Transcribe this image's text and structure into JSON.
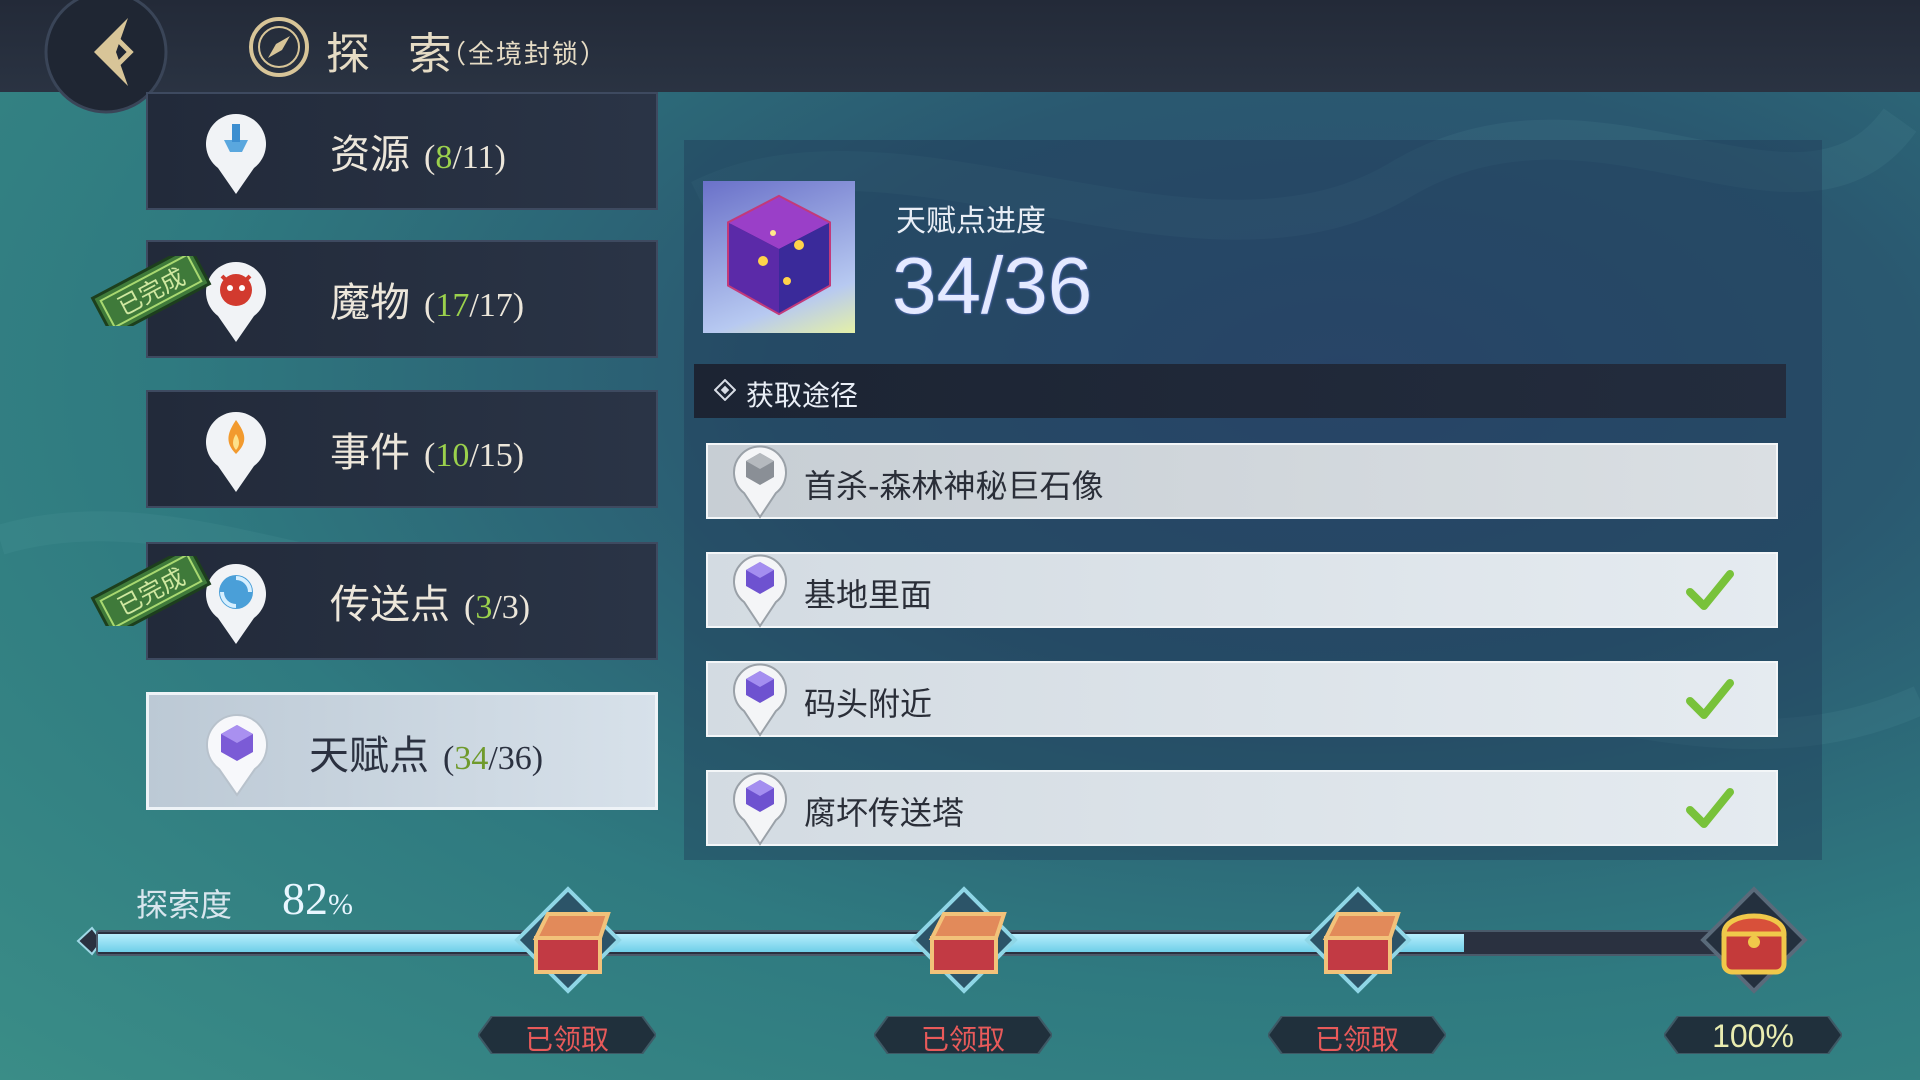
{
  "header": {
    "title": "探 索",
    "subtitle": "（全境封锁）"
  },
  "categories": [
    {
      "label": "资源",
      "done": "8",
      "total": "11",
      "completed": false,
      "stamp_text": ""
    },
    {
      "label": "魔物",
      "done": "17",
      "total": "17",
      "completed": true,
      "stamp_text": "已完成"
    },
    {
      "label": "事件",
      "done": "10",
      "total": "15",
      "completed": false,
      "stamp_text": ""
    },
    {
      "label": "传送点",
      "done": "3",
      "total": "3",
      "completed": true,
      "stamp_text": "已完成"
    },
    {
      "label": "天赋点",
      "done": "34",
      "total": "36",
      "completed": false,
      "selected": true,
      "stamp_text": ""
    }
  ],
  "detail": {
    "progress_label": "天赋点进度",
    "progress_value": "34/36",
    "ways_header": "获取途径",
    "ways": [
      {
        "label": "首杀-森林神秘巨石像",
        "obtained": false
      },
      {
        "label": "基地里面",
        "obtained": true
      },
      {
        "label": "码头附近",
        "obtained": true
      },
      {
        "label": "腐坏传送塔",
        "obtained": true
      }
    ]
  },
  "exploration": {
    "label": "探索度",
    "value": "82",
    "unit": "%",
    "progress_fraction": 0.82,
    "rewards": [
      {
        "label": "已领取",
        "claimed": true
      },
      {
        "label": "已领取",
        "claimed": true
      },
      {
        "label": "已领取",
        "claimed": true
      },
      {
        "label": "100%",
        "claimed": false
      }
    ]
  },
  "colors": {
    "accent_green": "#9bd14c",
    "check_green": "#78c23a",
    "claimed_red": "#e85a5a"
  },
  "icons": [
    "back-icon",
    "compass-icon",
    "resource-pin-icon",
    "monster-pin-icon",
    "event-pin-icon",
    "teleport-pin-icon",
    "talent-pin-icon",
    "talent-cube-icon",
    "check-icon",
    "chest-icon"
  ]
}
